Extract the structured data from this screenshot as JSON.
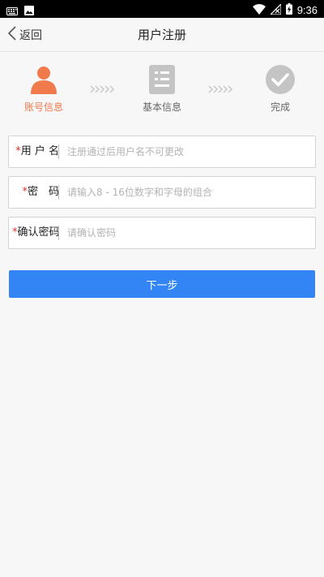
{
  "status_bar": {
    "time": "9:36"
  },
  "header": {
    "back_label": "返回",
    "title": "用户注册"
  },
  "steps": [
    {
      "label": "账号信息",
      "icon": "user-icon",
      "state": "active"
    },
    {
      "label": "基本信息",
      "icon": "document-icon",
      "state": "pending"
    },
    {
      "label": "完成",
      "icon": "check-circle-icon",
      "state": "pending"
    }
  ],
  "form": {
    "username": {
      "required_mark": "*",
      "label": "用 户 名",
      "placeholder": "注册通过后用户名不可更改",
      "value": ""
    },
    "password": {
      "required_mark": "*",
      "label": "密　码",
      "placeholder": "请输入8 - 16位数字和字母的组合",
      "value": ""
    },
    "confirm": {
      "required_mark": "*",
      "label": "确认密码",
      "placeholder": "请确认密码",
      "value": ""
    }
  },
  "next_button": {
    "label": "下一步"
  },
  "colors": {
    "accent": "#3385f5",
    "active_step": "#f07a4c",
    "inactive_step": "#c4c4c4",
    "required": "#e0312b"
  }
}
